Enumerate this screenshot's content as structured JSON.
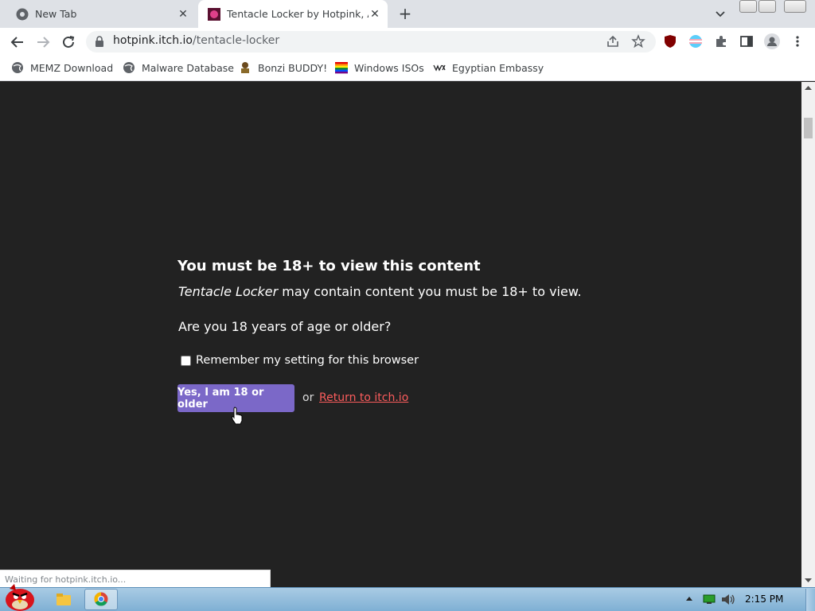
{
  "browser": {
    "tabs": [
      {
        "title": "New Tab",
        "active": false
      },
      {
        "title": "Tentacle Locker by Hotpink, Ar",
        "active": true
      }
    ],
    "url_host": "hotpink.itch.io",
    "url_path": "/tentacle-locker",
    "bookmarks": [
      {
        "label": "MEMZ Download",
        "icon": "globe-icon"
      },
      {
        "label": "Malware Database",
        "icon": "globe-icon"
      },
      {
        "label": "Bonzi BUDDY!",
        "icon": "bonzi-icon"
      },
      {
        "label": "Windows ISOs",
        "icon": "rainbow-flag-icon"
      },
      {
        "label": "Egyptian Embassy",
        "icon": "wix-icon"
      }
    ],
    "status_text": "Waiting for hotpink.itch.io..."
  },
  "page": {
    "heading": "You must be 18+ to view this content",
    "game_name": "Tentacle Locker",
    "warning_rest": " may contain content you must be 18+ to view.",
    "question": "Are you 18 years of age or older?",
    "remember_label": "Remember my setting for this browser",
    "remember_checked": false,
    "confirm_button": "Yes, I am 18 or older",
    "or_text": "or",
    "return_link": "Return to itch.io"
  },
  "taskbar": {
    "clock": "2:15 PM"
  },
  "colors": {
    "page_bg": "#222222",
    "button_bg": "#7b68c8",
    "link": "#fa5c5c"
  }
}
